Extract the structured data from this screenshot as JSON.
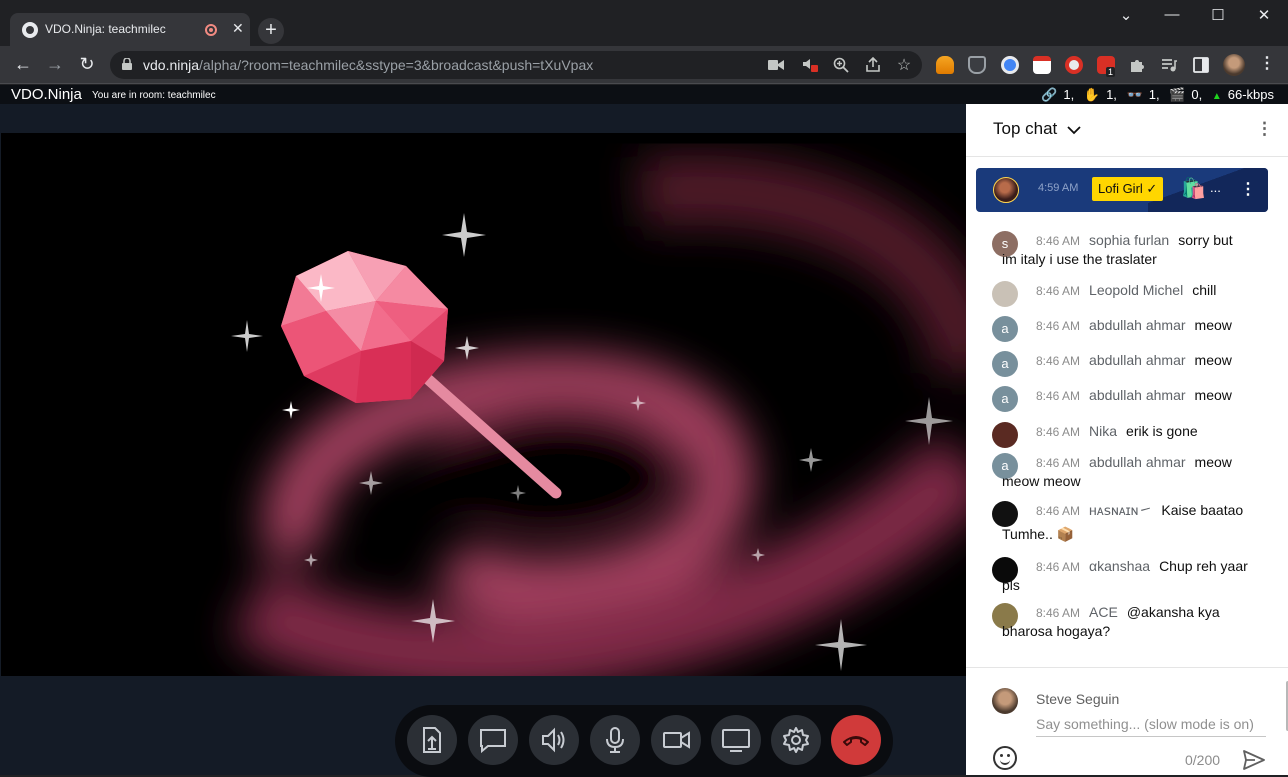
{
  "browser": {
    "tab_title": "VDO.Ninja: teachmilec",
    "tab_close": "✕",
    "new_tab": "+",
    "url_host": "vdo.ninja",
    "url_path": "/alpha/?room=teachmilec&sstype=3&broadcast&push=tXuVpax",
    "window_controls": [
      "⌄",
      "—",
      "☐",
      "✕"
    ],
    "nav": {
      "back": "←",
      "forward": "→",
      "reload": "↻"
    },
    "omnibox_icons": [
      "camera-icon",
      "blocked-sound-icon",
      "zoom-icon",
      "share-icon",
      "bookmark-star-icon"
    ],
    "extensions": [
      "cloud-extension-icon",
      "ublock-icon",
      "chrome-extension-icon",
      "calendar-extension-icon",
      "recorder-extension-icon",
      "badge-extension-icon",
      "puzzle-icon",
      "media-icon",
      "sidepanel-icon",
      "profile-avatar"
    ],
    "badge_count": "1"
  },
  "app": {
    "brand": "VDO.Ninja",
    "room_text": "You are in room: teachmilec",
    "stats": [
      {
        "icon": "link-icon",
        "glyph": "🔗",
        "value": "1,"
      },
      {
        "icon": "hand-icon",
        "glyph": "✋",
        "value": "1,"
      },
      {
        "icon": "glasses-icon",
        "glyph": "👓",
        "value": "1,"
      },
      {
        "icon": "clapper-icon",
        "glyph": "🎬",
        "value": "0,"
      },
      {
        "icon": "upload-arrow-icon",
        "glyph": "▲",
        "value": "66-kbps"
      }
    ],
    "controls": [
      "share-file-icon",
      "chat-icon",
      "speaker-icon",
      "microphone-icon",
      "camera-icon",
      "screen-share-icon",
      "settings-gear-icon",
      "hangup-icon"
    ]
  },
  "chat": {
    "title": "Top chat",
    "caret": "⌄",
    "menu": "⋮",
    "pinned": {
      "time": "4:59 AM",
      "author": "Lofi Girl ✓",
      "emoji": "🛍️",
      "ellipsis": "...",
      "menu": "⋮"
    },
    "messages": [
      {
        "avatar": "s",
        "avatar_color": "#8d6e63",
        "time": "8:46 AM",
        "author": "sophia furlan",
        "text": "sorry but",
        "text2": "im italy i use the traslater"
      },
      {
        "avatar": "",
        "avatar_color": "#c9c1b6",
        "time": "8:46 AM",
        "author": "Leopold Michel",
        "text": "chill",
        "text2": ""
      },
      {
        "avatar": "a",
        "avatar_color": "#78909c",
        "time": "8:46 AM",
        "author": "abdullah ahmar",
        "text": "meow",
        "text2": ""
      },
      {
        "avatar": "a",
        "avatar_color": "#78909c",
        "time": "8:46 AM",
        "author": "abdullah ahmar",
        "text": "meow",
        "text2": ""
      },
      {
        "avatar": "a",
        "avatar_color": "#78909c",
        "time": "8:46 AM",
        "author": "abdullah ahmar",
        "text": "meow",
        "text2": ""
      },
      {
        "avatar": "",
        "avatar_color": "#5a2a22",
        "time": "8:46 AM",
        "author": "Nika",
        "text": "erik is gone",
        "text2": ""
      },
      {
        "avatar": "a",
        "avatar_color": "#78909c",
        "time": "8:46 AM",
        "author": "abdullah ahmar",
        "text": "meow",
        "text2": "meow meow"
      },
      {
        "avatar": "",
        "avatar_color": "#111111",
        "time": "8:46 AM",
        "author": "ʜᴀꜱɴᴀɪɴ㇀",
        "text": "Kaise baatao",
        "text2": "Tumhe.. 📦"
      },
      {
        "avatar": "",
        "avatar_color": "#0a0a0a",
        "time": "8:46 AM",
        "author": "αkanshaa",
        "text": "Chup reh yaar",
        "text2": "pls"
      },
      {
        "avatar": "",
        "avatar_color": "#8a7a4a",
        "time": "8:46 AM",
        "author": "ACE",
        "text": "@akansha kya",
        "text2": "bharosa hogaya?"
      }
    ],
    "composer": {
      "name": "Steve Seguin",
      "placeholder": "Say something... (slow mode is on)",
      "count": "0/200"
    }
  }
}
